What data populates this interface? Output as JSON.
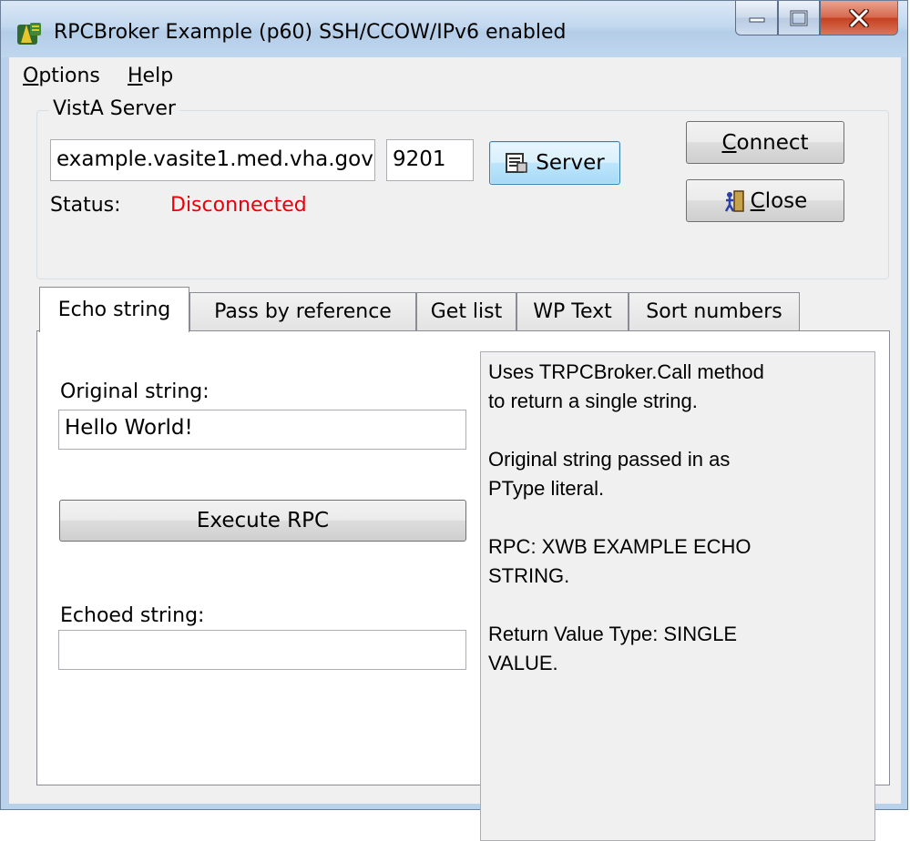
{
  "window": {
    "title": "RPCBroker Example (p60) SSH/CCOW/IPv6 enabled"
  },
  "menu": {
    "options": {
      "first": "O",
      "rest": "ptions"
    },
    "help": {
      "first": "H",
      "rest": "elp"
    }
  },
  "server": {
    "group_label": "VistA Server",
    "host_value": "example.vasite1.med.vha.gov",
    "port_value": "9201",
    "server_button": "Server",
    "connect_button": {
      "first": "C",
      "rest": "onnect"
    },
    "close_button": {
      "first": "C",
      "rest": "lose"
    },
    "status_label": "Status:",
    "status_value": "Disconnected",
    "status_color": "#e8000b"
  },
  "tabs": [
    {
      "label": "Echo string",
      "active": true
    },
    {
      "label": "Pass by reference",
      "active": false
    },
    {
      "label": "Get list",
      "active": false
    },
    {
      "label": "WP Text",
      "active": false
    },
    {
      "label": "Sort numbers",
      "active": false
    }
  ],
  "echo": {
    "original_label": "Original string:",
    "original_value": "Hello World!",
    "execute_button": "Execute RPC",
    "echoed_label": "Echoed string:",
    "echoed_value": "",
    "info_lines": [
      "Uses TRPCBroker.Call method",
      "to return a single string.",
      "",
      "Original string passed in as",
      "PType literal.",
      "",
      "RPC: XWB EXAMPLE ECHO",
      "STRING.",
      "",
      "Return Value Type: SINGLE",
      "VALUE."
    ]
  },
  "icons": {
    "app": "rpcbroker-app-icon",
    "server": "server-icon",
    "close": "door-exit-icon"
  }
}
